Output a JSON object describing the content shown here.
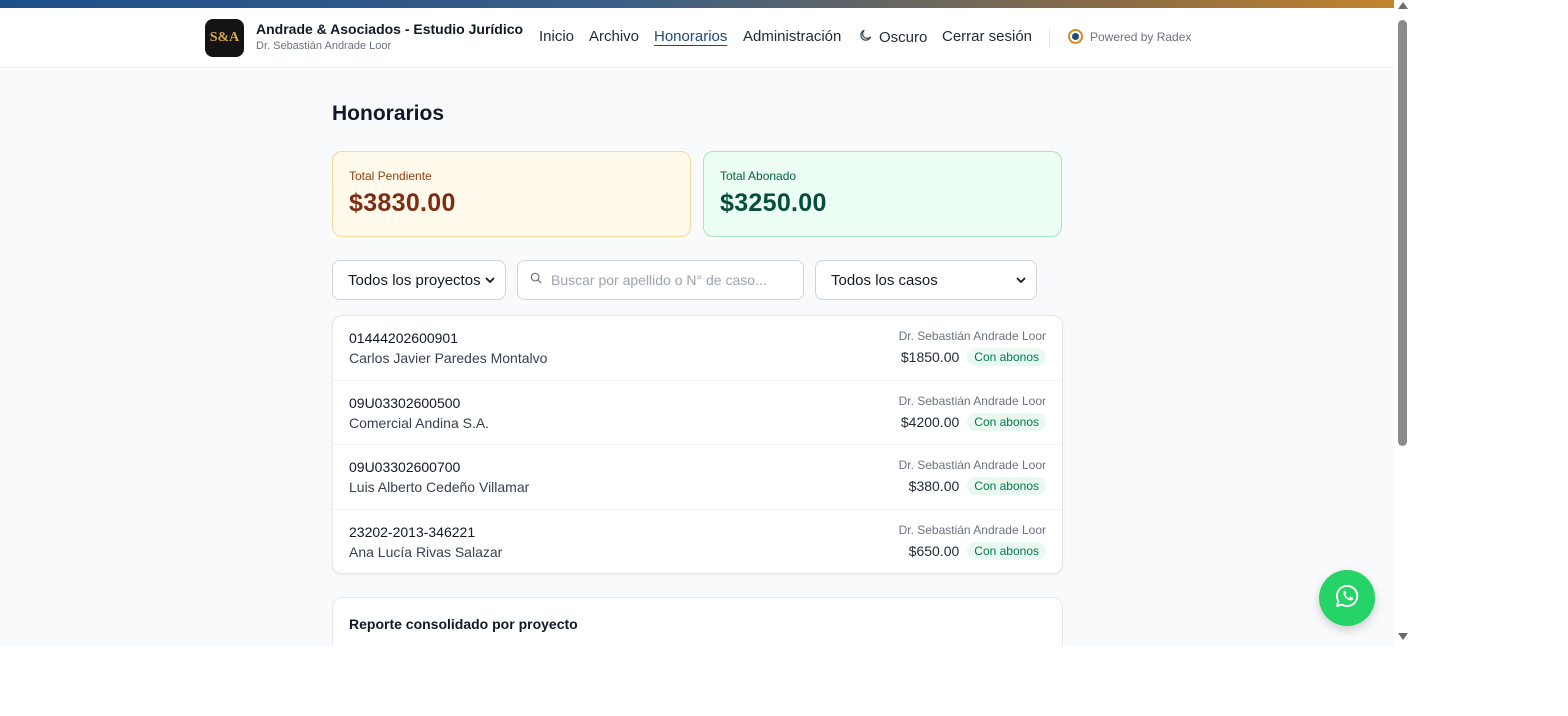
{
  "header": {
    "logo_text": "S&A",
    "brand_title": "Andrade & Asociados - Estudio Jurídico",
    "brand_subtitle": "Dr. Sebastián Andrade Loor",
    "nav": {
      "inicio": "Inicio",
      "archivo": "Archivo",
      "honorarios": "Honorarios",
      "administracion": "Administración",
      "oscuro": "Oscuro",
      "cerrar_sesion": "Cerrar sesión"
    },
    "active_nav": "Honorarios",
    "powered_by": "Powered by Radex"
  },
  "page": {
    "title": "Honorarios"
  },
  "summary": {
    "pending_label": "Total Pendiente",
    "pending_value": "$3830.00",
    "paid_label": "Total Abonado",
    "paid_value": "$3250.00"
  },
  "filters": {
    "projects_selected": "Todos los proyectos",
    "search_placeholder": "Buscar por apellido o N° de caso...",
    "search_value": "",
    "cases_selected": "Todos los casos"
  },
  "cases": [
    {
      "case_number": "01444202600901",
      "client": "Carlos Javier Paredes Montalvo",
      "lawyer": "Dr. Sebastián Andrade Loor",
      "amount": "$1850.00",
      "status": "Con abonos"
    },
    {
      "case_number": "09U03302600500",
      "client": "Comercial Andina S.A.",
      "lawyer": "Dr. Sebastián Andrade Loor",
      "amount": "$4200.00",
      "status": "Con abonos"
    },
    {
      "case_number": "09U03302600700",
      "client": "Luis Alberto Cedeño Villamar",
      "lawyer": "Dr. Sebastián Andrade Loor",
      "amount": "$380.00",
      "status": "Con abonos"
    },
    {
      "case_number": "23202-2013-346221",
      "client": "Ana Lucía Rivas Salazar",
      "lawyer": "Dr. Sebastián Andrade Loor",
      "amount": "$650.00",
      "status": "Con abonos"
    }
  ],
  "report": {
    "title": "Reporte consolidado por proyecto"
  },
  "icons": {
    "search": "search-icon",
    "moon": "moon-icon",
    "chevron": "chevron-down-icon",
    "whatsapp": "whatsapp-icon",
    "powered": "radex-dot-icon"
  },
  "colors": {
    "brand_primary": "#1e4a7a",
    "accent_gold": "#c2852c",
    "pending_bg": "#fffaeb",
    "paid_bg": "#ecfdf3",
    "badge_text": "#047857",
    "whatsapp": "#25d366"
  }
}
